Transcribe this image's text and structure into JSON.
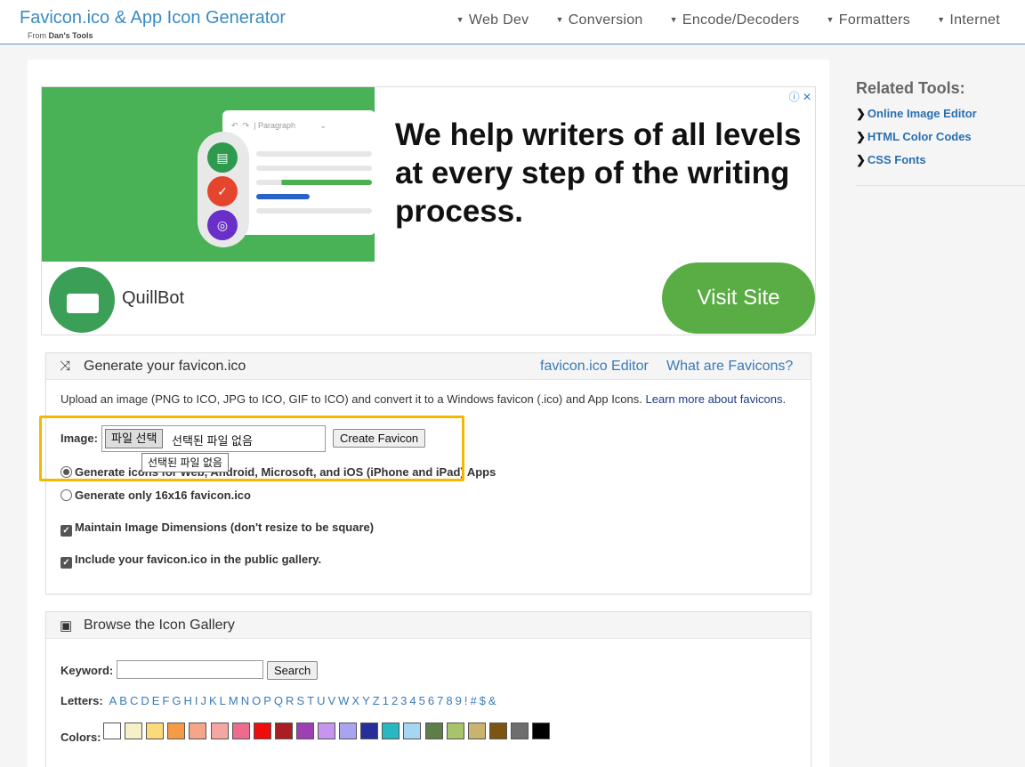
{
  "header": {
    "title": "Favicon.ico & App Icon Generator",
    "from_prefix": "From",
    "from_name": "Dan's Tools",
    "nav": [
      "Web Dev",
      "Conversion",
      "Encode/Decoders",
      "Formatters",
      "Internet"
    ]
  },
  "ad": {
    "headline": "We help writers of all levels at every step of the writing process.",
    "brand": "QuillBot",
    "cta": "Visit Site",
    "toolbar_text": "Paragraph",
    "info_icon": "info-close-icon"
  },
  "generate": {
    "title": "Generate your favicon.ico",
    "icon": "shuffle-icon",
    "link_editor": "favicon.ico Editor",
    "link_what": "What are Favicons?",
    "description": "Upload an image (PNG to ICO, JPG to ICO, GIF to ICO) and convert it to a Windows favicon (.ico) and App Icons.",
    "learn_more": "Learn more about favicons",
    "learn_more_suffix": ".",
    "image_label": "Image:",
    "file_button": "파일 선택",
    "file_status": "선택된 파일 없음",
    "tooltip": "선택된 파일 없음",
    "create_button": "Create Favicon",
    "option_all": "Generate icons for Web, Android, Microsoft, and iOS (iPhone and iPad) Apps",
    "option_16": "Generate only 16x16 favicon.ico",
    "maintain": "Maintain Image Dimensions (don't resize to be square)",
    "gallery_include": "Include your favicon.ico in the public gallery."
  },
  "browse": {
    "title": "Browse the Icon Gallery",
    "icon": "image-icon",
    "keyword_label": "Keyword:",
    "keyword_value": "",
    "search_button": "Search",
    "letters_label": "Letters:",
    "letters": [
      "A",
      "B",
      "C",
      "D",
      "E",
      "F",
      "G",
      "H",
      "I",
      "J",
      "K",
      "L",
      "M",
      "N",
      "O",
      "P",
      "Q",
      "R",
      "S",
      "T",
      "U",
      "V",
      "W",
      "X",
      "Y",
      "Z",
      "1",
      "2",
      "3",
      "4",
      "5",
      "6",
      "7",
      "8",
      "9",
      "!",
      "#",
      "$",
      "&"
    ],
    "colors_label": "Colors:",
    "colors": [
      "#ffffff",
      "#f5f0c8",
      "#fcd97a",
      "#f79a46",
      "#f4a58a",
      "#f4a6a3",
      "#ee6a8e",
      "#ee0c0c",
      "#a81e23",
      "#9d3fb5",
      "#c595f0",
      "#a8a4f2",
      "#252e9a",
      "#27b8c2",
      "#a7d6f2",
      "#5d7d49",
      "#a7c46a",
      "#c9b36e",
      "#7d5512",
      "#6e6e6e",
      "#000000"
    ]
  },
  "sidebar": {
    "title": "Related Tools:",
    "links": [
      "Online Image Editor",
      "HTML Color Codes",
      "CSS Fonts"
    ]
  }
}
